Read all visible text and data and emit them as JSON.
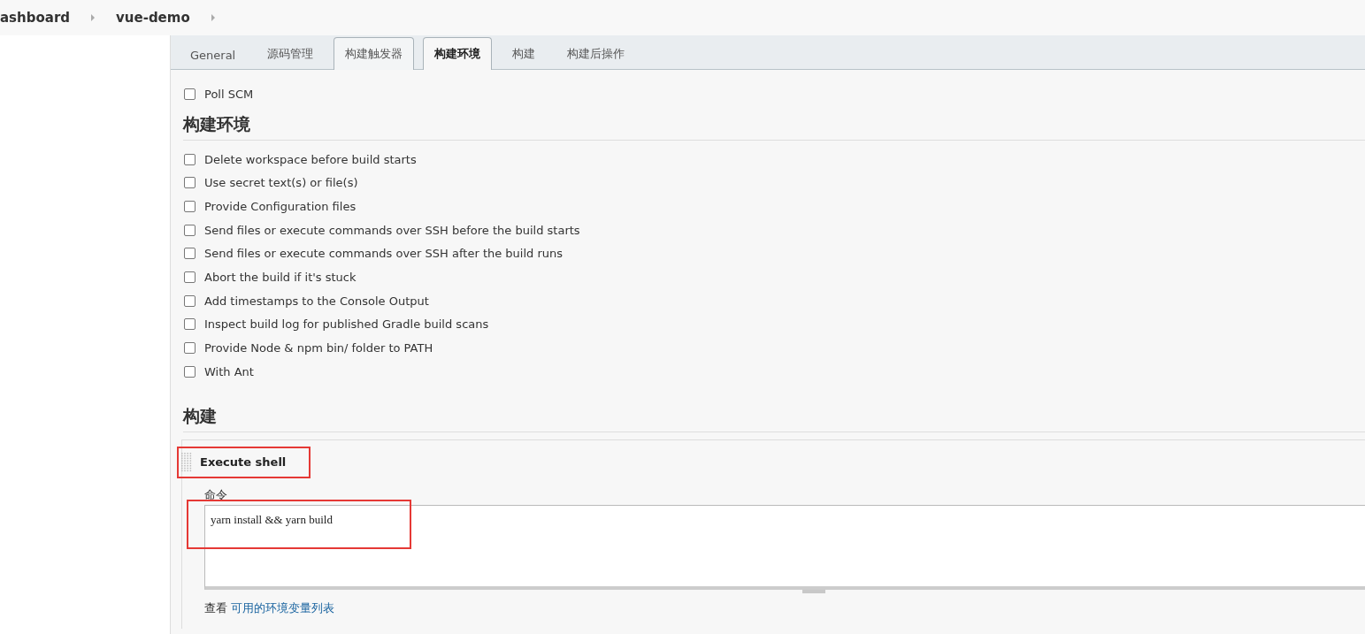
{
  "breadcrumbs": [
    {
      "label": "ashboard"
    },
    {
      "label": "vue-demo"
    }
  ],
  "tabs": [
    {
      "label": "General",
      "selected": false,
      "outlined": false
    },
    {
      "label": "源码管理",
      "selected": false,
      "outlined": false
    },
    {
      "label": "构建触发器",
      "selected": false,
      "outlined": true
    },
    {
      "label": "构建环境",
      "selected": true,
      "outlined": true
    },
    {
      "label": "构建",
      "selected": false,
      "outlined": false
    },
    {
      "label": "构建后操作",
      "selected": false,
      "outlined": false
    }
  ],
  "triggers": [
    {
      "label": "Poll SCM",
      "checked": false
    }
  ],
  "sections": [
    {
      "title": "构建环境",
      "options": [
        {
          "label": "Delete workspace before build starts",
          "checked": false
        },
        {
          "label": "Use secret text(s) or file(s)",
          "checked": false
        },
        {
          "label": "Provide Configuration files",
          "checked": false
        },
        {
          "label": "Send files or execute commands over SSH before the build starts",
          "checked": false
        },
        {
          "label": "Send files or execute commands over SSH after the build runs",
          "checked": false
        },
        {
          "label": "Abort the build if it's stuck",
          "checked": false
        },
        {
          "label": "Add timestamps to the Console Output",
          "checked": false
        },
        {
          "label": "Inspect build log for published Gradle build scans",
          "checked": false
        },
        {
          "label": "Provide Node & npm bin/ folder to PATH",
          "checked": false
        },
        {
          "label": "With Ant",
          "checked": false
        }
      ]
    },
    {
      "title": "构建",
      "steps": [
        {
          "title": "Execute shell",
          "highlighted": true,
          "field_label": "命令",
          "value": "yarn install && yarn build",
          "value_highlighted": true,
          "help_prefix": "查看",
          "help_link": "可用的环境变量列表"
        }
      ]
    }
  ]
}
